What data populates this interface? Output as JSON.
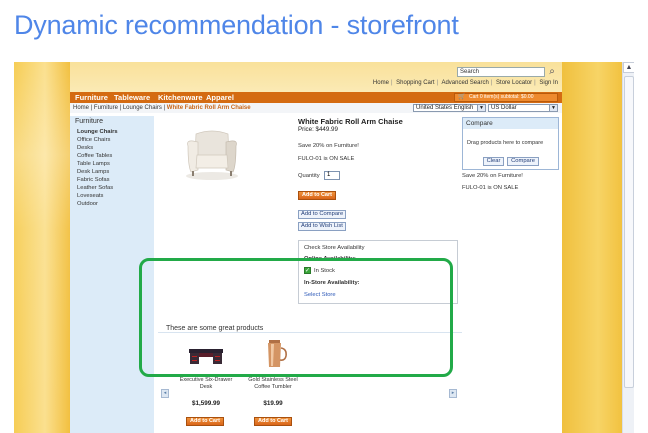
{
  "slide": {
    "title": "Dynamic recommendation - storefront"
  },
  "colors": {
    "title": "#4f86e8",
    "nav": "#d46b12",
    "highlight": "#22aa48",
    "sidebar": "#dcebf8"
  },
  "header": {
    "search_value": "Search",
    "search_icon": "magnifier-icon",
    "links": [
      "Home",
      "Shopping Cart",
      "Advanced Search",
      "Store Locator",
      "Sign In"
    ]
  },
  "nav": {
    "items": [
      "Furniture",
      "Tableware",
      "Kitchenware",
      "Apparel"
    ],
    "cart": "Cart 0 item(s) subtotal: $0.00"
  },
  "breadcrumb": {
    "items": [
      "Home",
      "Furniture",
      "Lounge Chairs"
    ],
    "current": "White Fabric Roll Arm Chaise"
  },
  "selectors": {
    "language": "United States English",
    "currency": "US Dollar"
  },
  "sidebar": {
    "title": "Furniture",
    "items": [
      "Lounge Chairs",
      "Office Chairs",
      "Desks",
      "Coffee Tables",
      "Table Lamps",
      "Desk Lamps",
      "Fabric Sofas",
      "Leather Sofas",
      "Loveseats",
      "Outdoor"
    ]
  },
  "product": {
    "title": "White Fabric Roll Arm Chaise",
    "price": "Price: $449.99",
    "promo": "Save 20% on Furniture!",
    "sale": "FULO-01 is ON SALE",
    "qty_label": "Quantity",
    "qty_value": "1",
    "add_to_cart": "Add to Cart",
    "add_to_compare": "Add to Compare",
    "add_to_wishlist": "Add to Wish List"
  },
  "compare": {
    "title": "Compare",
    "text": "Drag products here to compare",
    "clear": "Clear",
    "compare": "Compare",
    "promo": "Save 20% on Furniture!",
    "sale": "FULO-01 is ON SALE"
  },
  "availability": {
    "title": "Check Store Availability",
    "online_label": "Online Availability:",
    "in_stock": "In Stock",
    "instore_label": "In-Store Availability:",
    "select_store": "Select Store"
  },
  "recs": {
    "title": "These are some great products",
    "items": [
      {
        "name_line1": "Executive Six-Drawer",
        "name_line2": "Desk",
        "price": "$1,599.99",
        "button": "Add to Cart"
      },
      {
        "name_line1": "Gold Stainless Steel",
        "name_line2": "Coffee Tumbler",
        "price": "$19.99",
        "button": "Add to Cart"
      }
    ]
  }
}
